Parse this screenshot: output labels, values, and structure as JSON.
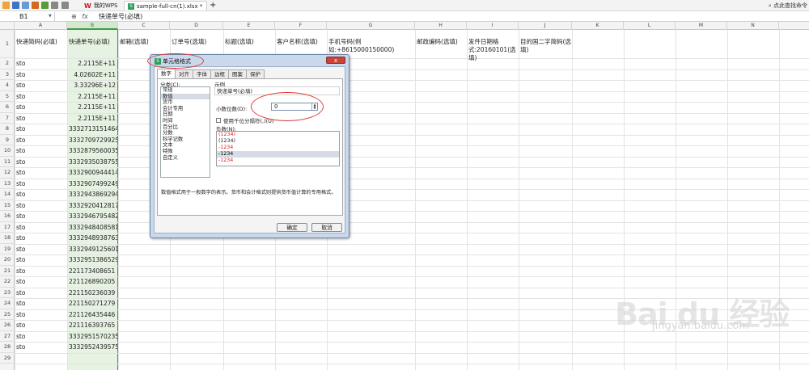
{
  "titlebar": {
    "tab_mywps": "我的WPS",
    "tab_file": "sample-full-cn(1).xlsx *",
    "new_tab": "+",
    "right_search": "点此查找命令"
  },
  "formula": {
    "cell_ref": "B1",
    "fx": "fx",
    "content": "快递单号(必填)"
  },
  "columns": [
    "A",
    "B",
    "C",
    "D",
    "E",
    "F",
    "G",
    "H",
    "I",
    "J",
    "K",
    "L",
    "M",
    "N"
  ],
  "rows": [
    "1",
    "2",
    "3",
    "4",
    "5",
    "6",
    "7",
    "8",
    "9",
    "10",
    "11",
    "12",
    "13",
    "14",
    "15",
    "16",
    "17",
    "18",
    "19",
    "20",
    "21",
    "22",
    "23",
    "24",
    "25",
    "26",
    "27",
    "28",
    "29"
  ],
  "sheet": {
    "headers": {
      "a": "快递简码(必填)",
      "b": "快递单号(必填)",
      "c": "邮箱(选填)",
      "d": "订单号(选填)",
      "e": "标题(选填)",
      "f": "客户名称(选填)",
      "g": "手机号码(例如:+8615000150000)",
      "h": "邮政编码(选填)",
      "i": "发件日期格式:20160101(选填)",
      "j": "目的国二字简码(选填)"
    },
    "col_a": [
      "sto",
      "sto",
      "sto",
      "sto",
      "sto",
      "sto",
      "sto",
      "sto",
      "sto",
      "sto",
      "sto",
      "sto",
      "sto",
      "sto",
      "sto",
      "sto",
      "sto",
      "sto",
      "sto",
      "sto",
      "sto",
      "sto",
      "sto",
      "sto",
      "sto",
      "sto",
      "sto"
    ],
    "col_b": [
      "2.2115E+11",
      "4.02602E+11",
      "3.33296E+12",
      "2.2115E+11",
      "2.2115E+11",
      "2.2115E+11",
      "3332713151464",
      "3332709729925",
      "3332879560035",
      "3332935038755",
      "3332900944414",
      "3332907499249",
      "3332943869294",
      "3332920412817",
      "3332946795482",
      "3332948408581",
      "3332948938763",
      "3332949125601",
      "3332951386529",
      "221173408651",
      "221126890205",
      "221150236039",
      "221150271279",
      "221126435446",
      "221116393765",
      "3332951570235",
      "3332952439575"
    ]
  },
  "dialog": {
    "title": "单元格格式",
    "close": "x",
    "tabs": [
      "数字",
      "对齐",
      "字体",
      "边框",
      "图案",
      "保护"
    ],
    "category_label": "分类(C):",
    "categories": [
      "常规",
      "数值",
      "货币",
      "会计专用",
      "日期",
      "时间",
      "百分比",
      "分数",
      "科学记数",
      "文本",
      "特殊",
      "自定义"
    ],
    "sample_label": "示例",
    "sample_value": "快递单号(必填)",
    "decimal_label": "小数位数(D):",
    "decimal_value": "0",
    "thousands_label": "使用千位分隔符(,)(U)",
    "negative_label": "负数(N):",
    "negatives": [
      "(1234)",
      "(1234)",
      "-1234",
      "-1234",
      "-1234"
    ],
    "description": "数值格式用于一般数字的表示。货币和会计格式则提供货币值计算的专用格式。",
    "ok": "确定",
    "cancel": "取消"
  },
  "watermark": {
    "brand": "Bai du 经验",
    "url": "jingyan.baidu.com"
  },
  "colors": {
    "accent_green": "#3d9e4a",
    "annotation_red": "#e03a3a",
    "negative_red": "#e02020"
  }
}
